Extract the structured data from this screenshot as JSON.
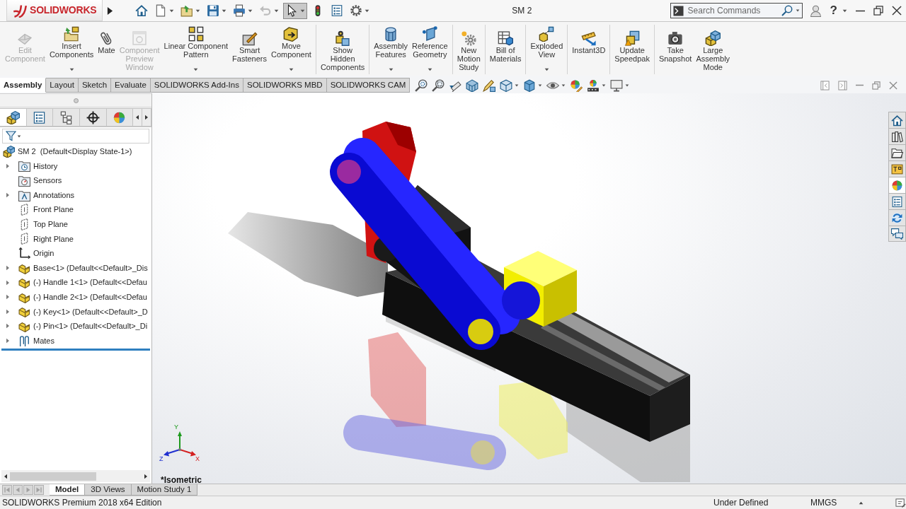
{
  "window": {
    "title": "SM 2"
  },
  "logo": {
    "wordmark": "SOLIDWORKS"
  },
  "quick_access": [
    {
      "kind": "home",
      "dropdown": false,
      "pressed": false,
      "disabled": false
    },
    {
      "kind": "new",
      "dropdown": true,
      "pressed": false,
      "disabled": false
    },
    {
      "kind": "open",
      "dropdown": true,
      "pressed": false,
      "disabled": false
    },
    {
      "kind": "save",
      "dropdown": true,
      "pressed": false,
      "disabled": false
    },
    {
      "kind": "print",
      "dropdown": true,
      "pressed": false,
      "disabled": false
    },
    {
      "kind": "undo",
      "dropdown": true,
      "pressed": false,
      "disabled": true
    },
    {
      "kind": "select",
      "dropdown": true,
      "pressed": true,
      "disabled": false
    },
    {
      "kind": "rebuild",
      "dropdown": false,
      "pressed": false,
      "disabled": false
    },
    {
      "kind": "file-properties",
      "dropdown": false,
      "pressed": false,
      "disabled": false
    },
    {
      "kind": "options",
      "dropdown": true,
      "pressed": false,
      "disabled": false
    }
  ],
  "search": {
    "placeholder": "Search Commands"
  },
  "help": {
    "glyph": "?"
  },
  "ribbon": {
    "groups": [
      {
        "commands": [
          {
            "kind": "edit-component",
            "label": "Edit\nComponent",
            "disabled": true,
            "dropdown": false
          },
          {
            "kind": "insert-components",
            "label": "Insert\nComponents",
            "disabled": false,
            "dropdown": true
          },
          {
            "kind": "mate",
            "label": "Mate",
            "disabled": false,
            "dropdown": false
          },
          {
            "kind": "component-preview",
            "label": "Component\nPreview\nWindow",
            "disabled": true,
            "dropdown": false
          },
          {
            "kind": "linear-pattern",
            "label": "Linear Component\nPattern",
            "disabled": false,
            "dropdown": true
          },
          {
            "kind": "smart-fasteners",
            "label": "Smart\nFasteners",
            "disabled": false,
            "dropdown": false
          },
          {
            "kind": "move-component",
            "label": "Move\nComponent",
            "disabled": false,
            "dropdown": true
          }
        ]
      },
      {
        "commands": [
          {
            "kind": "show-hidden",
            "label": "Show\nHidden\nComponents",
            "disabled": false,
            "dropdown": false
          }
        ]
      },
      {
        "commands": [
          {
            "kind": "assembly-features",
            "label": "Assembly\nFeatures",
            "disabled": false,
            "dropdown": true
          },
          {
            "kind": "reference-geometry",
            "label": "Reference\nGeometry",
            "disabled": false,
            "dropdown": true
          }
        ]
      },
      {
        "commands": [
          {
            "kind": "motion-study",
            "label": "New\nMotion\nStudy",
            "disabled": false,
            "dropdown": false
          }
        ]
      },
      {
        "commands": [
          {
            "kind": "bom",
            "label": "Bill of\nMaterials",
            "disabled": false,
            "dropdown": false
          }
        ]
      },
      {
        "commands": [
          {
            "kind": "exploded-view",
            "label": "Exploded\nView",
            "disabled": false,
            "dropdown": true
          }
        ]
      },
      {
        "commands": [
          {
            "kind": "instant3d",
            "label": "Instant3D",
            "disabled": false,
            "dropdown": false
          }
        ]
      },
      {
        "commands": [
          {
            "kind": "speedpak",
            "label": "Update\nSpeedpak",
            "disabled": false,
            "dropdown": false
          }
        ]
      },
      {
        "commands": [
          {
            "kind": "snapshot",
            "label": "Take\nSnapshot",
            "disabled": false,
            "dropdown": false
          },
          {
            "kind": "large-assembly",
            "label": "Large\nAssembly\nMode",
            "disabled": false,
            "dropdown": false
          }
        ]
      }
    ]
  },
  "command_tabs": [
    {
      "label": "Assembly",
      "selected": true
    },
    {
      "label": "Layout",
      "selected": false
    },
    {
      "label": "Sketch",
      "selected": false
    },
    {
      "label": "Evaluate",
      "selected": false
    },
    {
      "label": "SOLIDWORKS Add-Ins",
      "selected": false
    },
    {
      "label": "SOLIDWORKS MBD",
      "selected": false
    },
    {
      "label": "SOLIDWORKS CAM",
      "selected": false
    }
  ],
  "view_toolbar": [
    {
      "kind": "zoom-fit",
      "dropdown": false
    },
    {
      "kind": "zoom-area",
      "dropdown": false
    },
    {
      "kind": "previous-view",
      "dropdown": false
    },
    {
      "kind": "section-view",
      "dropdown": false
    },
    {
      "kind": "dynamic-annotation",
      "dropdown": false
    },
    {
      "kind": "view-orientation",
      "dropdown": true
    },
    {
      "kind": "display-style",
      "dropdown": true
    },
    {
      "kind": "hide-show",
      "dropdown": true
    },
    {
      "kind": "edit-appearance",
      "dropdown": false
    },
    {
      "kind": "scenes",
      "dropdown": true
    },
    {
      "kind": "view-settings",
      "dropdown": true
    }
  ],
  "feature_manager": {
    "tabs": [
      {
        "kind": "feature-tree",
        "selected": true
      },
      {
        "kind": "property-manager",
        "selected": false
      },
      {
        "kind": "configuration",
        "selected": false
      },
      {
        "kind": "dimxpert",
        "selected": false
      },
      {
        "kind": "display-manager",
        "selected": false
      }
    ],
    "tree": {
      "kind": "assembly",
      "label": "SM 2  (Default<Display State-1>)",
      "children": [
        {
          "kind": "history",
          "label": "History",
          "expandable": true
        },
        {
          "kind": "sensors",
          "label": "Sensors",
          "expandable": false
        },
        {
          "kind": "annotations",
          "label": "Annotations",
          "expandable": true
        },
        {
          "kind": "plane",
          "label": "Front Plane",
          "expandable": false
        },
        {
          "kind": "plane",
          "label": "Top Plane",
          "expandable": false
        },
        {
          "kind": "plane",
          "label": "Right Plane",
          "expandable": false
        },
        {
          "kind": "origin",
          "label": "Origin",
          "expandable": false
        },
        {
          "kind": "part",
          "label": "Base<1> (Default<<Default>_Dis",
          "expandable": true
        },
        {
          "kind": "part",
          "label": "(-) Handle 1<1> (Default<<Defau",
          "expandable": true
        },
        {
          "kind": "part",
          "label": "(-) Handle 2<1> (Default<<Defau",
          "expandable": true
        },
        {
          "kind": "part",
          "label": "(-) Key<1> (Default<<Default>_D",
          "expandable": true
        },
        {
          "kind": "part",
          "label": "(-) Pin<1> (Default<<Default>_Di",
          "expandable": true
        },
        {
          "kind": "mates",
          "label": "Mates",
          "expandable": true
        }
      ]
    }
  },
  "graphics": {
    "view_name": "*Isometric",
    "triad": {
      "axes": [
        {
          "kind": "y",
          "label": "Y"
        },
        {
          "kind": "z",
          "label": "Z"
        },
        {
          "kind": "x",
          "label": "X"
        }
      ]
    }
  },
  "task_pane": [
    {
      "kind": "home",
      "selected": false
    },
    {
      "kind": "library",
      "selected": false
    },
    {
      "kind": "explorer",
      "selected": false
    },
    {
      "kind": "view-palette",
      "selected": false
    },
    {
      "kind": "appearances",
      "selected": true
    },
    {
      "kind": "custom-properties",
      "selected": false
    },
    {
      "kind": "sync",
      "selected": false
    },
    {
      "kind": "forum",
      "selected": false
    }
  ],
  "model_tabs": [
    {
      "label": "Model",
      "selected": true
    },
    {
      "label": "3D Views",
      "selected": false
    },
    {
      "label": "Motion Study 1",
      "selected": false
    }
  ],
  "status_bar": {
    "edition": "SOLIDWORKS Premium 2018 x64 Edition",
    "state": "Under Defined",
    "units": "MMGS"
  }
}
